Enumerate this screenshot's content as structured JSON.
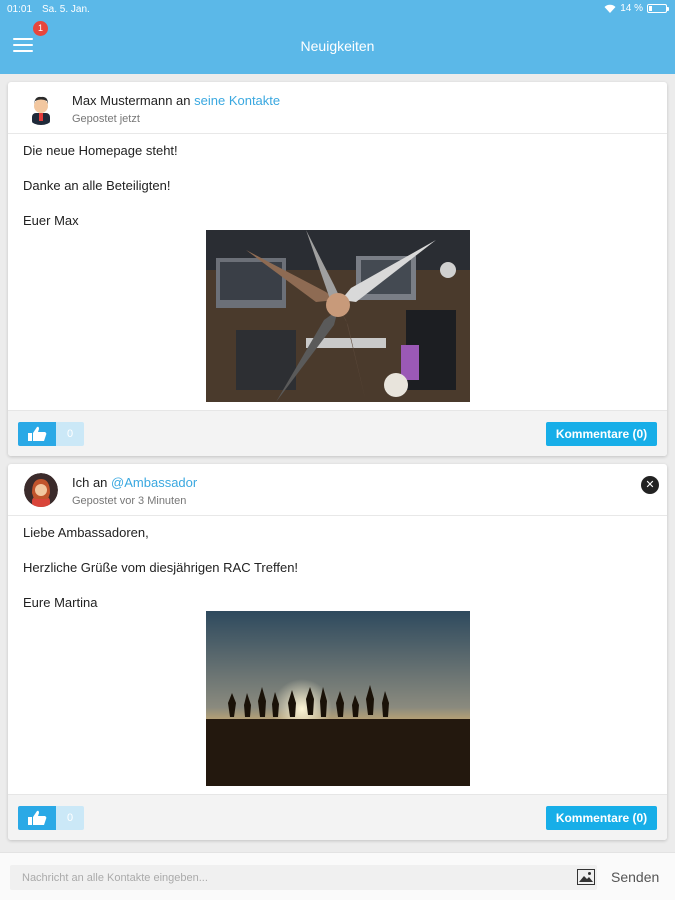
{
  "status_bar": {
    "time": "01:01",
    "date": "Sa. 5. Jan.",
    "battery": "14 %"
  },
  "header": {
    "title": "Neuigkeiten",
    "menu_badge": "1",
    "accent_color": "#5bb8e8"
  },
  "posts": [
    {
      "author": "Max Mustermann an",
      "target": "seine Kontakte",
      "posted": "Gepostet jetzt",
      "lines": [
        "Die neue Homepage steht!",
        "Danke an alle Beteiligten!",
        "Euer Max"
      ],
      "likes": "0",
      "comments_label": "Kommentare (0)",
      "image_icon": "team-fist-bump-photo"
    },
    {
      "author": "Ich an",
      "target": "@Ambassador",
      "posted": "Gepostet vor 3 Minuten",
      "lines": [
        "Liebe Ambassadoren,",
        "Herzliche Grüße vom diesjährigen RAC Treffen!",
        "Eure Martina"
      ],
      "likes": "0",
      "comments_label": "Kommentare (0)",
      "image_icon": "sunset-jumping-people-photo"
    }
  ],
  "composer": {
    "placeholder": "Nachricht an alle Kontakte eingeben...",
    "send_label": "Senden"
  }
}
